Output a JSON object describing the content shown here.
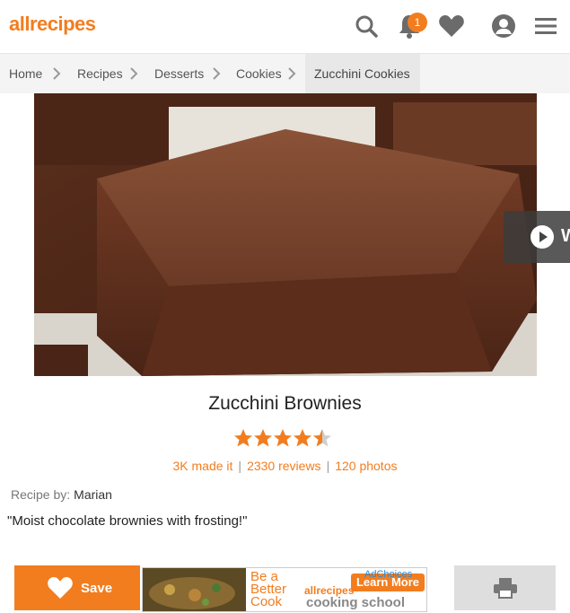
{
  "header": {
    "logo_text": "allrecipes",
    "notification_count": "1",
    "icons": [
      "search-icon",
      "bell-icon",
      "heart-icon",
      "user-icon",
      "menu-icon"
    ]
  },
  "breadcrumb": {
    "items": [
      "Home",
      "Recipes",
      "Desserts",
      "Cookies"
    ],
    "current": "Zucchini Cookies"
  },
  "video_button": {
    "label": "W"
  },
  "recipe": {
    "title": "Zucchini Brownies",
    "rating": 4.5,
    "made_it": "3K made it",
    "reviews": "2330 reviews",
    "photos": "120 photos",
    "byline_label": "Recipe by:",
    "author": "Marian",
    "description": "\"Moist chocolate brownies with frosting!\""
  },
  "actions": {
    "save_label": "Save"
  },
  "ad": {
    "headline": "Be a Better Cook",
    "brand": "allrecipes",
    "cta": "Learn More",
    "subline": "cooking school",
    "adchoices": "AdChoices"
  },
  "colors": {
    "accent": "#f27d1f",
    "breadcrumb_bg": "#f4f4f4",
    "print_bg": "#dedede"
  }
}
